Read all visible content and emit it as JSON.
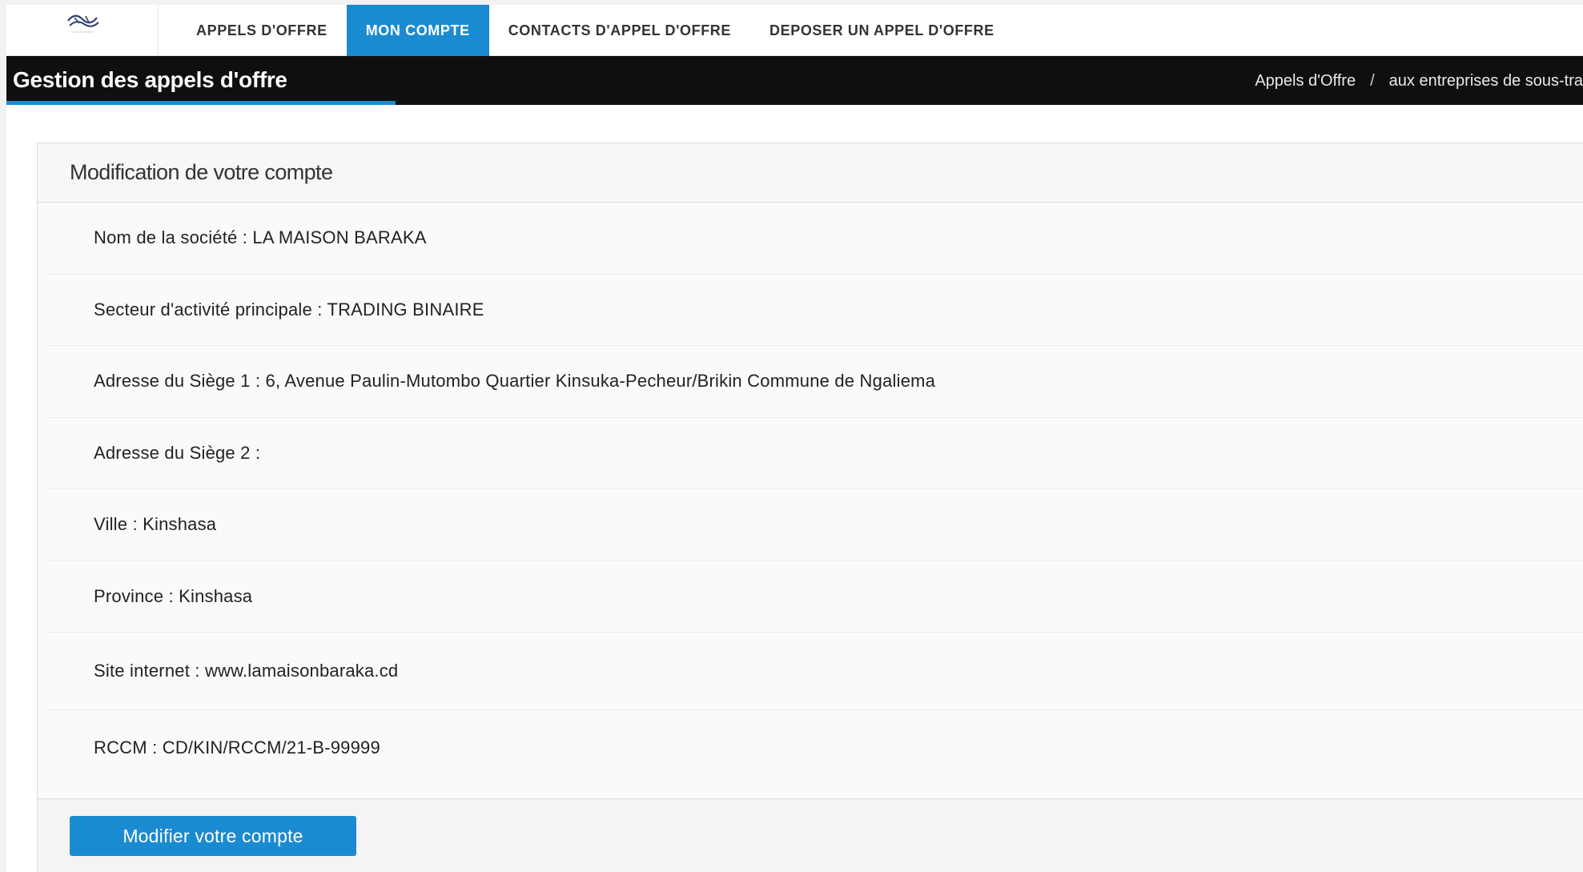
{
  "nav": {
    "items": [
      {
        "label": "APPELS D'OFFRE"
      },
      {
        "label": "MON COMPTE"
      },
      {
        "label": "CONTACTS D'APPEL D'OFFRE"
      },
      {
        "label": "DEPOSER UN APPEL D'OFFRE"
      }
    ],
    "active_index": 1
  },
  "header": {
    "title": "Gestion des appels d'offre",
    "breadcrumb": [
      "Appels d'Offre",
      "aux entreprises de sous-tra"
    ],
    "breadcrumb_separator": "/"
  },
  "panel": {
    "heading": "Modification de votre compte",
    "fields": [
      {
        "label": "Nom de la société : LA MAISON BARAKA"
      },
      {
        "label": "Secteur d'activité principale : TRADING BINAIRE"
      },
      {
        "label": "Adresse du Siège 1 : 6, Avenue Paulin-Mutombo Quartier Kinsuka-Pecheur/Brikin Commune de Ngaliema"
      },
      {
        "label": "Adresse du Siège 2 :"
      },
      {
        "label": "Ville : Kinshasa"
      },
      {
        "label": "Province : Kinshasa"
      },
      {
        "label": "Site internet : www.lamaisonbaraka.cd"
      },
      {
        "label": "RCCM : CD/KIN/RCCM/21-B-99999"
      }
    ],
    "button_label": "Modifier votre compte"
  },
  "colors": {
    "accent": "#1a8bd1",
    "titlebar": "#0f0f0f"
  },
  "icons": {
    "logo": "company-logo-icon"
  }
}
